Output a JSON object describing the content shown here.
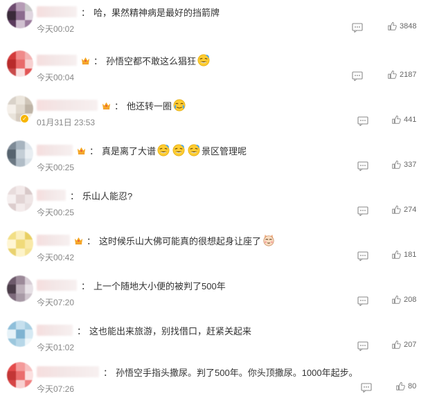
{
  "comments": [
    {
      "text": "哈，果然精神病是最好的挡箭牌",
      "time": "今天00:02",
      "likes": "3848",
      "crown": false,
      "emoji_after": [],
      "text_after": "",
      "verified": false
    },
    {
      "text": "孙悟空都不敢这么猖狂",
      "time": "今天00:04",
      "likes": "2187",
      "crown": true,
      "emoji_after": [
        "laugh-emoji"
      ],
      "text_after": "",
      "verified": false
    },
    {
      "text": "他还转一圈",
      "time": "01月31日 23:53",
      "likes": "441",
      "crown": true,
      "emoji_after": [
        "tears-emoji"
      ],
      "text_after": "",
      "verified": true
    },
    {
      "text": "真是离了大谱",
      "time": "今天00:25",
      "likes": "337",
      "crown": true,
      "emoji_after": [
        "laugh-emoji",
        "laugh-emoji",
        "laugh-emoji"
      ],
      "text_after": "景区管理呢",
      "verified": false
    },
    {
      "text": "乐山人能忍?",
      "time": "今天00:25",
      "likes": "274",
      "crown": false,
      "emoji_after": [],
      "text_after": "",
      "verified": false
    },
    {
      "text": "这时候乐山大佛可能真的很想起身让座了",
      "time": "今天00:42",
      "likes": "181",
      "crown": true,
      "emoji_after": [
        "cat-emoji"
      ],
      "text_after": "",
      "verified": false
    },
    {
      "text": "上一个随地大小便的被判了500年",
      "time": "今天07:20",
      "likes": "208",
      "crown": false,
      "emoji_after": [],
      "text_after": "",
      "verified": false
    },
    {
      "text": "这也能出来旅游，别找借口，赶紧关起来",
      "time": "今天01:02",
      "likes": "207",
      "crown": false,
      "emoji_after": [],
      "text_after": "",
      "verified": false
    },
    {
      "text": "孙悟空手指头撒尿。判了500年。你头顶撒尿。1000年起步。",
      "time": "今天07:26",
      "likes": "80",
      "crown": false,
      "emoji_after": [],
      "text_after": "",
      "verified": false
    }
  ],
  "icons": {
    "reply": "comment-icon",
    "like": "thumbs-up-icon",
    "crown": "crown-badge-icon"
  },
  "colors": {
    "time": "#888888",
    "text": "#333333",
    "crown": "#f5a623"
  }
}
